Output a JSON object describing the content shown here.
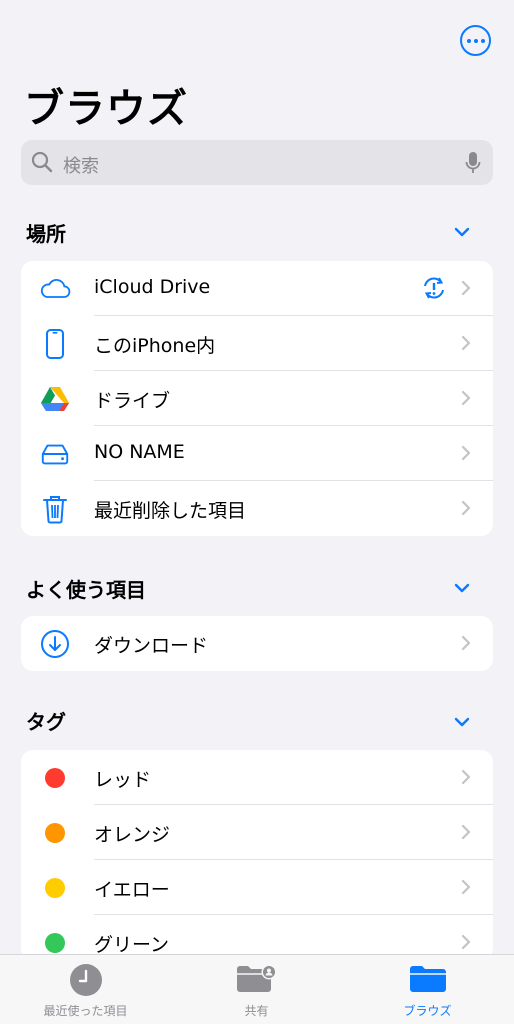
{
  "header": {
    "title": "ブラウズ",
    "more_icon": "ellipsis-circle-icon"
  },
  "search": {
    "placeholder": "検索"
  },
  "sections": {
    "locations": {
      "title": "場所",
      "items": [
        {
          "label": "iCloud Drive",
          "icon": "icloud-icon"
        },
        {
          "label": "このiPhone内",
          "icon": "iphone-icon"
        },
        {
          "label": "ドライブ",
          "icon": "google-drive-icon"
        },
        {
          "label": "NO NAME",
          "icon": "external-drive-icon"
        },
        {
          "label": "最近削除した項目",
          "icon": "trash-icon"
        }
      ]
    },
    "favorites": {
      "title": "よく使う項目",
      "items": [
        {
          "label": "ダウンロード",
          "icon": "download-circle-icon"
        }
      ]
    },
    "tags": {
      "title": "タグ",
      "items": [
        {
          "label": "レッド",
          "color": "#ff3b30"
        },
        {
          "label": "オレンジ",
          "color": "#ff9500"
        },
        {
          "label": "イエロー",
          "color": "#ffcc00"
        },
        {
          "label": "グリーン",
          "color": "#34c759"
        }
      ]
    }
  },
  "tabbar": {
    "tabs": [
      {
        "label": "最近使った項目",
        "icon": "clock-icon"
      },
      {
        "label": "共有",
        "icon": "shared-folder-icon"
      },
      {
        "label": "ブラウズ",
        "icon": "folder-icon"
      }
    ],
    "active_tab": "ブラウズ"
  },
  "colors": {
    "accent": "#0a7aff",
    "background": "#f2f2f7"
  }
}
